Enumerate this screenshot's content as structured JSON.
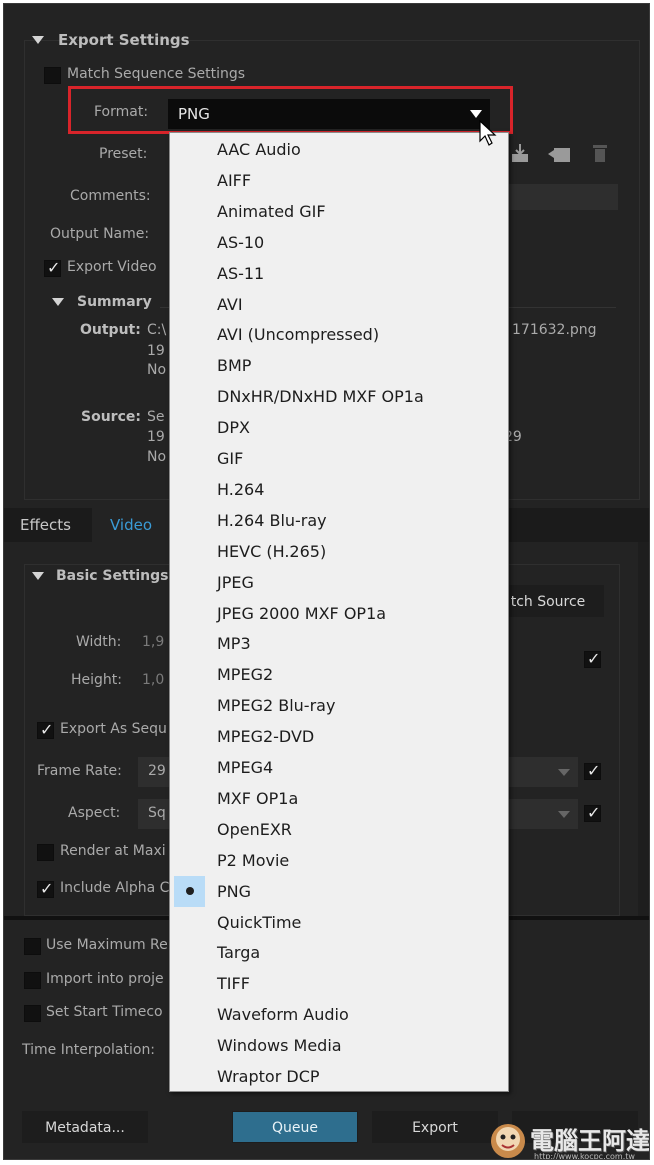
{
  "export_settings": {
    "section_title": "Export Settings",
    "match_sequence": "Match Sequence Settings",
    "format_label": "Format:",
    "format_value": "PNG",
    "preset_label": "Preset:",
    "comments_label": "Comments:",
    "output_name_label": "Output Name:",
    "export_video": "Export Video"
  },
  "summary": {
    "title": "Summary",
    "output_label": "Output:",
    "output_line1_left": "C:\\",
    "output_line1_right": "171632.png",
    "output_line2": "19",
    "output_line3": "No",
    "source_label": "Source:",
    "source_line1": "Se",
    "source_line2": "19",
    "source_line2_right": "29",
    "source_line3": "No"
  },
  "tabs": [
    "Effects",
    "Video"
  ],
  "basic_settings": {
    "title": "Basic Settings",
    "match_source": "tch Source",
    "width_label": "Width:",
    "width_value": "1,9",
    "height_label": "Height:",
    "height_value": "1,0",
    "export_as_sequence": "Export As Sequ",
    "frame_rate_label": "Frame Rate:",
    "frame_rate_value": "29",
    "aspect_label": "Aspect:",
    "aspect_value": "Sq",
    "render_at_max": "Render at Maxi",
    "include_alpha": "Include Alpha C"
  },
  "bottom_options": {
    "use_max": "Use Maximum Re",
    "import_into": "Import into proje",
    "set_start": "Set Start Timeco",
    "time_interp": "Time Interpolation:"
  },
  "buttons": {
    "metadata": "Metadata...",
    "queue": "Queue",
    "export": "Export"
  },
  "format_options": [
    "AAC Audio",
    "AIFF",
    "Animated GIF",
    "AS-10",
    "AS-11",
    "AVI",
    "AVI (Uncompressed)",
    "BMP",
    "DNxHR/DNxHD MXF OP1a",
    "DPX",
    "GIF",
    "H.264",
    "H.264 Blu-ray",
    "HEVC (H.265)",
    "JPEG",
    "JPEG 2000 MXF OP1a",
    "MP3",
    "MPEG2",
    "MPEG2 Blu-ray",
    "MPEG2-DVD",
    "MPEG4",
    "MXF OP1a",
    "OpenEXR",
    "P2 Movie",
    "PNG",
    "QuickTime",
    "Targa",
    "TIFF",
    "Waveform Audio",
    "Windows Media",
    "Wraptor DCP"
  ],
  "selected_format_index": 24,
  "watermark": {
    "text": "電腦王阿達",
    "url": "http://www.kocpc.com.tw"
  },
  "colors": {
    "accent": "#2e6e8e",
    "highlight": "#d8242a",
    "selection": "#b9dcf7",
    "tab_active": "#3a9bd6"
  }
}
